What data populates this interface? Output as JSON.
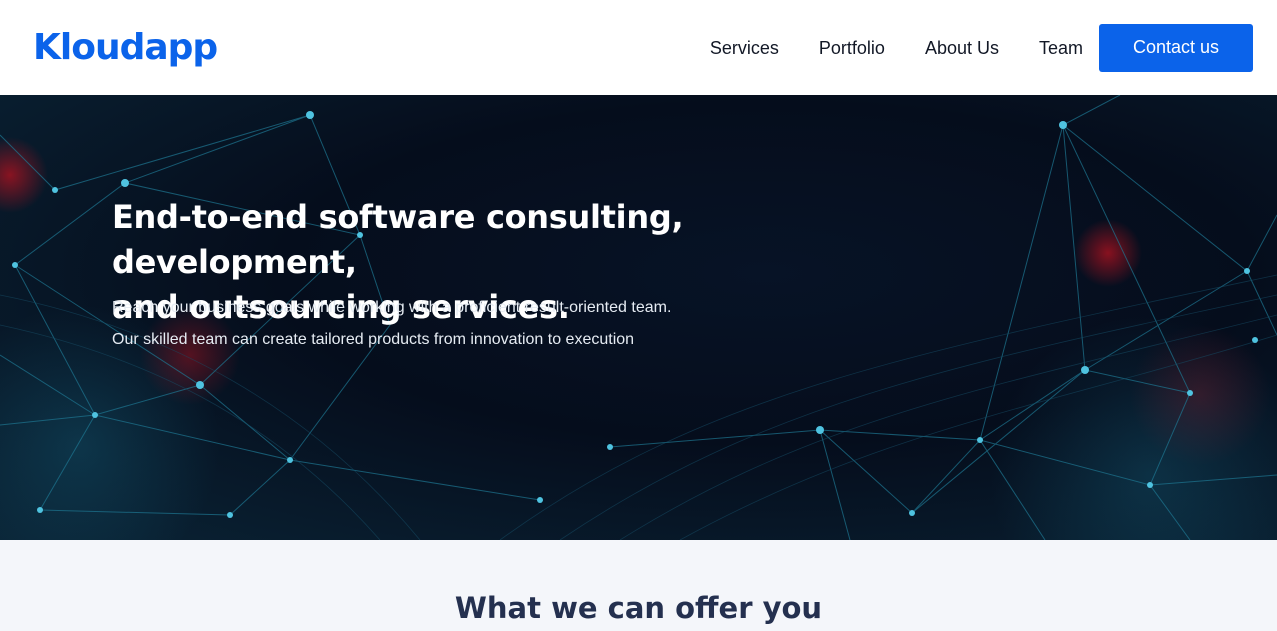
{
  "header": {
    "logo_text": "Kloudapp",
    "nav": {
      "services": "Services",
      "portfolio": "Portfolio",
      "about": "About Us",
      "team": "Team"
    },
    "contact_label": "Contact us"
  },
  "hero": {
    "title_line1": "End-to-end software consulting, development,",
    "title_line2": "and outsourcing services.",
    "subtitle_1": "Reach your business goals while working with a proficient result-oriented team.",
    "subtitle_2": "Our skilled team can create tailored products from innovation to execution"
  },
  "offer": {
    "title": "What we can offer you"
  },
  "colors": {
    "brand": "#0b63ea",
    "nav_text": "#121826",
    "hero_bg": "#050d1c",
    "network_lines": "#1d6f8a",
    "offer_bg": "#f4f6fa",
    "offer_title": "#24304f"
  }
}
